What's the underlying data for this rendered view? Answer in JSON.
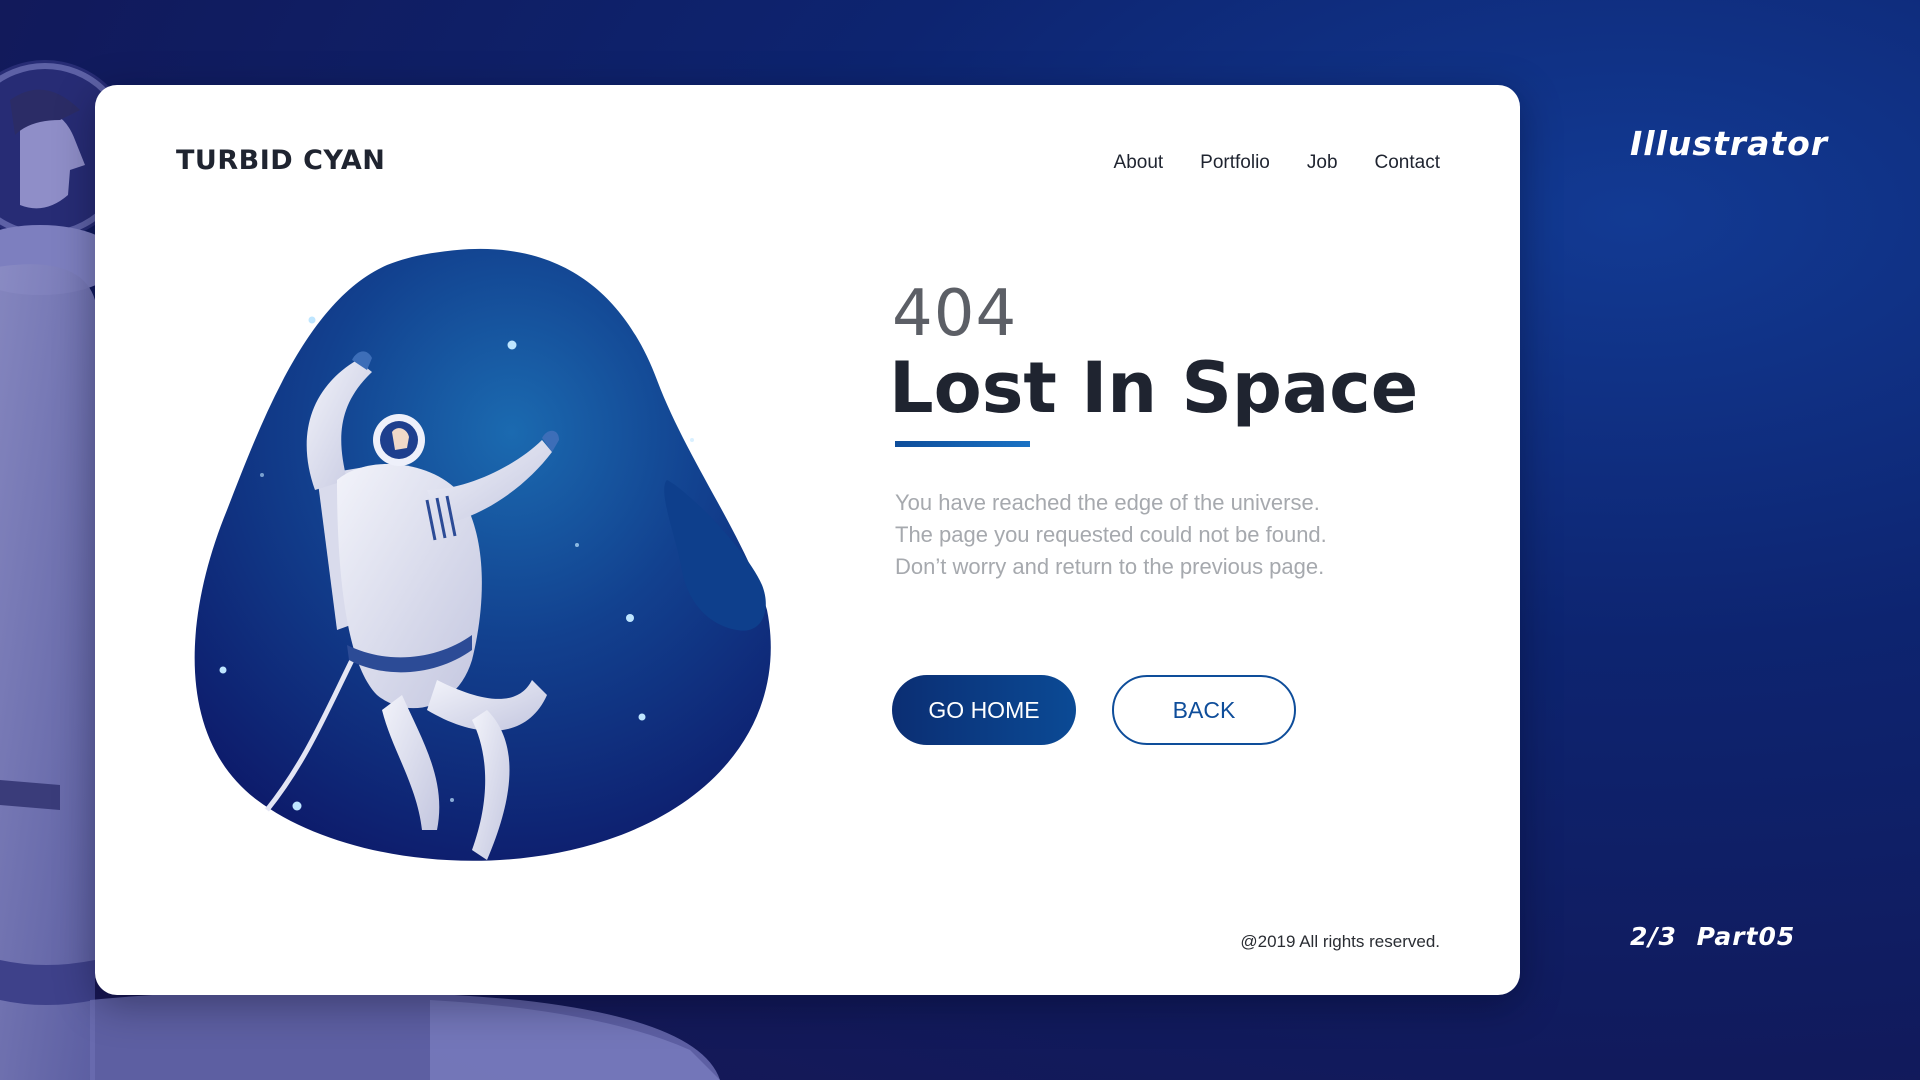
{
  "side": {
    "title": "Illustrator",
    "page": "2/3  Part05"
  },
  "header": {
    "brand": "TURBID CYAN",
    "nav": [
      "About",
      "Portfolio",
      "Job",
      "Contact"
    ]
  },
  "error": {
    "code": "404",
    "title": "Lost In Space",
    "description": [
      "You have reached the edge of the universe.",
      "The page you requested could not be found.",
      "Don’t worry and return to the previous page."
    ]
  },
  "buttons": {
    "home": "GO HOME",
    "back": "BACK"
  },
  "footer": {
    "copyright": "@2019 All rights reserved."
  },
  "colors": {
    "background": "#0d2470",
    "card": "#ffffff",
    "accent": "#0e4d9a",
    "title": "#1f2430",
    "muted_text": "#a6a9ae"
  },
  "icons": {
    "illustration": "astronaut-floating-in-space-blob",
    "background_illustration": "astronaut-closeup"
  }
}
